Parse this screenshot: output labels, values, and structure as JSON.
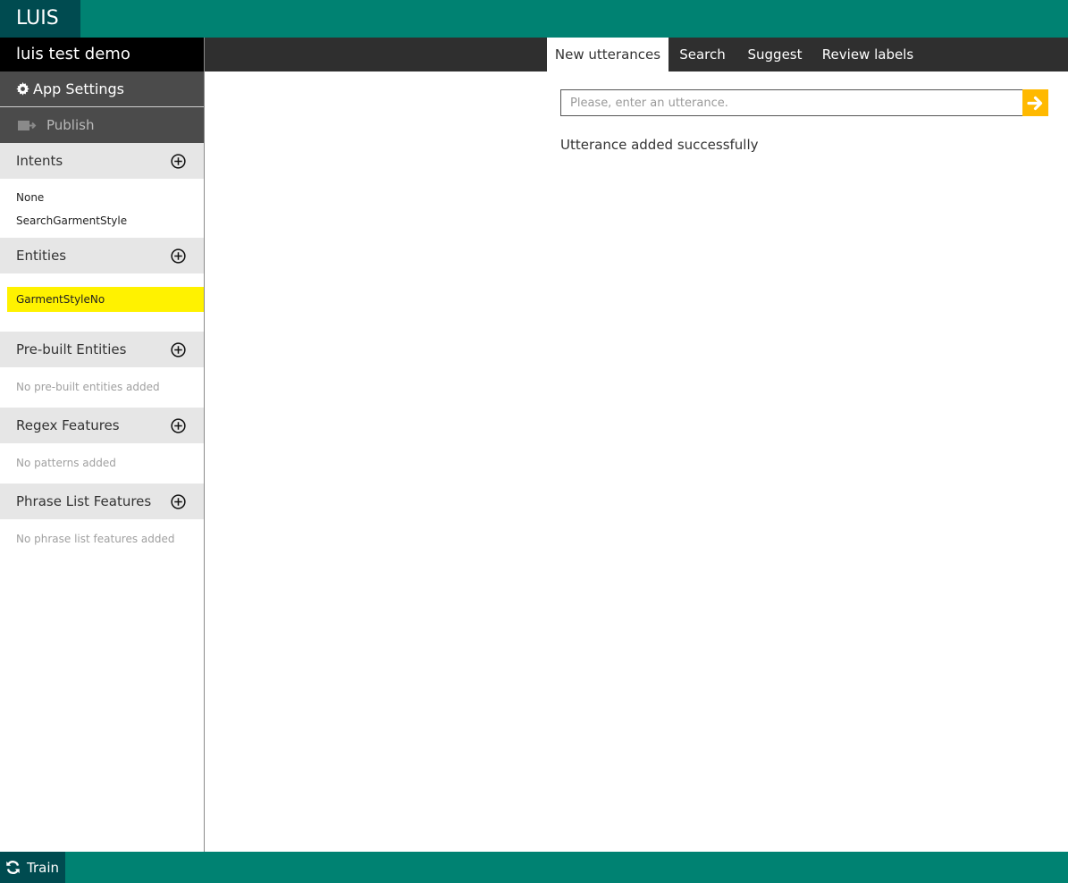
{
  "app": {
    "logo": "LUIS",
    "name": "luis test demo"
  },
  "sidebar": {
    "app_settings": "App Settings",
    "publish": "Publish",
    "sections": {
      "intents": {
        "title": "Intents",
        "items": [
          "None",
          "SearchGarmentStyle"
        ]
      },
      "entities": {
        "title": "Entities",
        "items": [
          "GarmentStyleNo"
        ]
      },
      "prebuilt": {
        "title": "Pre-built Entities",
        "empty": "No pre-built entities added"
      },
      "regex": {
        "title": "Regex Features",
        "empty": "No patterns added"
      },
      "phrase": {
        "title": "Phrase List Features",
        "empty": "No phrase list features added"
      }
    }
  },
  "tabs": [
    "New utterances",
    "Search",
    "Suggest",
    "Review labels"
  ],
  "utterance": {
    "placeholder": "Please, enter an utterance.",
    "value": ""
  },
  "status": "Utterance added successfully",
  "footer": {
    "train": "Train"
  },
  "colors": {
    "brand": "#008272",
    "brand_dark": "#004b50",
    "accent": "#ffb900",
    "highlight": "#fff200"
  }
}
